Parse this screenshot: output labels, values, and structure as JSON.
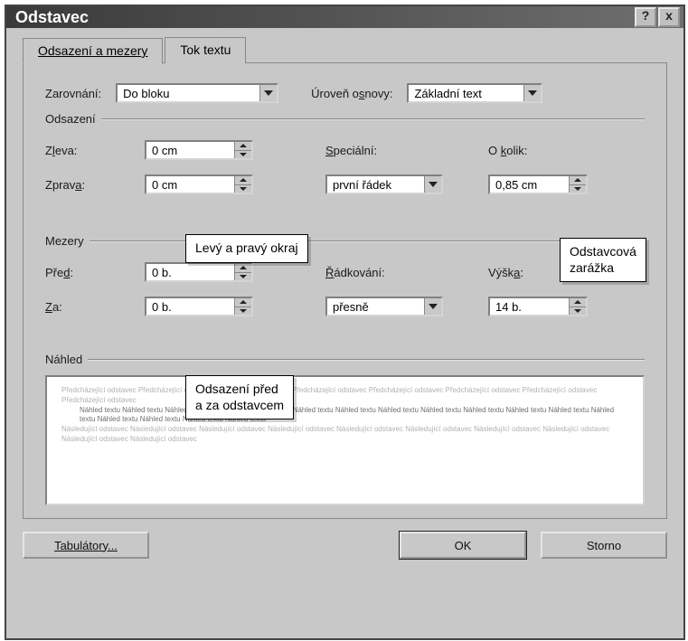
{
  "window_title": "Odstavec",
  "titlebar_buttons": {
    "help": "?",
    "close": "x"
  },
  "tabs": [
    {
      "label": "Odsazení a mezery",
      "active": true
    },
    {
      "label": "Tok textu",
      "active": false
    }
  ],
  "alignment": {
    "label": "Zarovnání:",
    "value": "Do bloku",
    "outline_label": "Úroveň osnovy:",
    "outline_value": "Základní text"
  },
  "odsazeni": {
    "title": "Odsazení",
    "left_label": "Zleva:",
    "left_value": "0 cm",
    "right_label": "Zprava:",
    "right_value": "0 cm",
    "special_label": "Speciální:",
    "special_value": "první řádek",
    "by_label": "O kolik:",
    "by_value": "0,85 cm"
  },
  "mezery": {
    "title": "Mezery",
    "before_label": "Před:",
    "before_value": "0 b.",
    "after_label": "Za:",
    "after_value": "0 b.",
    "line_spacing_label": "Řádkování:",
    "line_spacing_value": "přesně",
    "at_label": "Výška:",
    "at_value": "14 b."
  },
  "preview_label": "Náhled",
  "preview": {
    "before_text": "Předcházející odstavec Předcházející odstavec Předcházející odstavec Předcházející odstavec Předcházející odstavec Předcházející odstavec Předcházející odstavec Předcházející odstavec",
    "sample_text": "Náhled textu Náhled textu Náhled textu Náhled textu Náhled textu Náhled textu Náhled textu Náhled textu Náhled textu Náhled textu Náhled textu Náhled textu Náhled textu Náhled textu Náhled textu Náhled textu Náhled textu",
    "after_text": "Následující odstavec Následující odstavec Následující odstavec Následující odstavec Následující odstavec Následující odstavec Následující odstavec Následující odstavec Následující odstavec Následující odstavec"
  },
  "buttons": {
    "tabs": "Tabulátory...",
    "ok": "OK",
    "cancel": "Storno"
  },
  "annotations": {
    "left_right_margin": "Levý a pravý okraj",
    "paragraph_indent": "Odstavcová\nzarážka",
    "spacing_para": "Odsazení před\na za odstavcem"
  }
}
